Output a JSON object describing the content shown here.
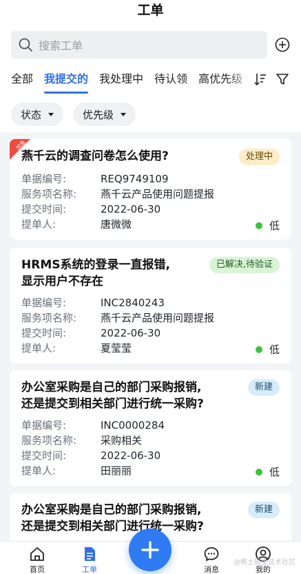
{
  "header": {
    "title": "工单"
  },
  "search": {
    "placeholder": "搜索工单"
  },
  "tabs": [
    {
      "label": "全部"
    },
    {
      "label": "我提交的"
    },
    {
      "label": "我处理中"
    },
    {
      "label": "待认领"
    },
    {
      "label": "高优先级"
    }
  ],
  "filters": {
    "status_label": "状态",
    "priority_label": "优先级"
  },
  "field_labels": {
    "number": "单据编号:",
    "service": "服务项名称:",
    "time": "提交时间:",
    "submitter": "提单人:"
  },
  "tickets": [
    {
      "urgent_tag": "加急",
      "title_line1": "燕千云的调查问卷怎么使用?",
      "title_line2": "",
      "status": "处理中",
      "number": "REQ9749109",
      "service": "燕千云产品使用问题提报",
      "time": "2022-06-30",
      "submitter": "唐微微",
      "priority": "低"
    },
    {
      "title_line1": "HRMS系统的登录一直报错,",
      "title_line2": "显示用户不存在",
      "status": "已解决,待验证",
      "number": "INC2840243",
      "service": "燕千云产品使用问题提报",
      "time": "2022-06-30",
      "submitter": "夏莹莹",
      "priority": "低"
    },
    {
      "title_line1": "办公室采购是自己的部门采购报销,",
      "title_line2": "还是提交到相关部门进行统一采购?",
      "status": "新建",
      "number": "INC0000284",
      "service": "采购相关",
      "time": "2022-06-30",
      "submitter": "田丽丽",
      "priority": "低"
    },
    {
      "title_line1": "办公室采购是自己的部门采购报销,",
      "title_line2": "还是提交到相关部门进行统一采购?",
      "status": "新建"
    }
  ],
  "bottom_nav": [
    {
      "label": "首页"
    },
    {
      "label": "工单"
    },
    {
      "label": "消息"
    },
    {
      "label": "我的"
    }
  ],
  "watermark": "@稀土掘金技术社区",
  "colors": {
    "accent": "#2f6fed",
    "fab": "#2f7bf3",
    "priority_low": "#3ec13e"
  }
}
